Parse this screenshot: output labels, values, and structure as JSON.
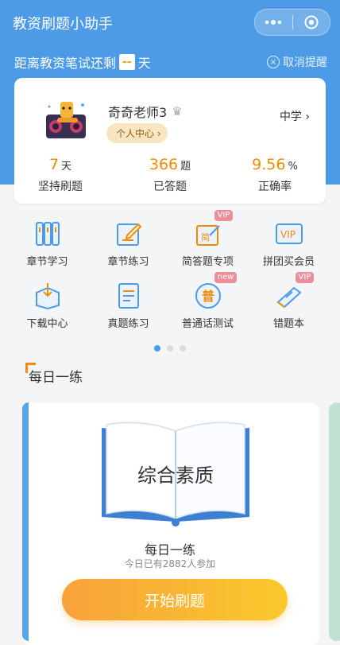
{
  "app": {
    "title": "教资刷题小助手"
  },
  "countdown": {
    "prefix": "距离教资笔试还剩",
    "days": "--",
    "suffix": "天",
    "cancel_label": "取消提醒"
  },
  "profile": {
    "name": "奇奇老师3",
    "center_button": "个人中心",
    "level": "中学"
  },
  "stats": [
    {
      "value": "7",
      "unit": "天",
      "label": "坚持刷题"
    },
    {
      "value": "366",
      "unit": "题",
      "label": "已答题"
    },
    {
      "value": "9.56",
      "unit": "%",
      "label": "正确率"
    }
  ],
  "menu": [
    {
      "label": "章节学习"
    },
    {
      "label": "章节练习"
    },
    {
      "label": "简答题专项",
      "badge": "VIP"
    },
    {
      "label": "拼团买会员"
    },
    {
      "label": "下载中心"
    },
    {
      "label": "真题练习"
    },
    {
      "label": "普通话测试",
      "badge": "new"
    },
    {
      "label": "错题本",
      "badge": "VIP"
    }
  ],
  "daily": {
    "section_title": "每日一练",
    "book_title": "综合素质",
    "card_title": "每日一练",
    "participants": "今日已有2882人参加",
    "start_button": "开始刷题"
  },
  "icons": {
    "jian": "简",
    "vip": "VIP",
    "pu": "普"
  },
  "colors": {
    "brand": "#4d9be6",
    "accent": "#f08c00",
    "badge": "#ea8f9a"
  }
}
